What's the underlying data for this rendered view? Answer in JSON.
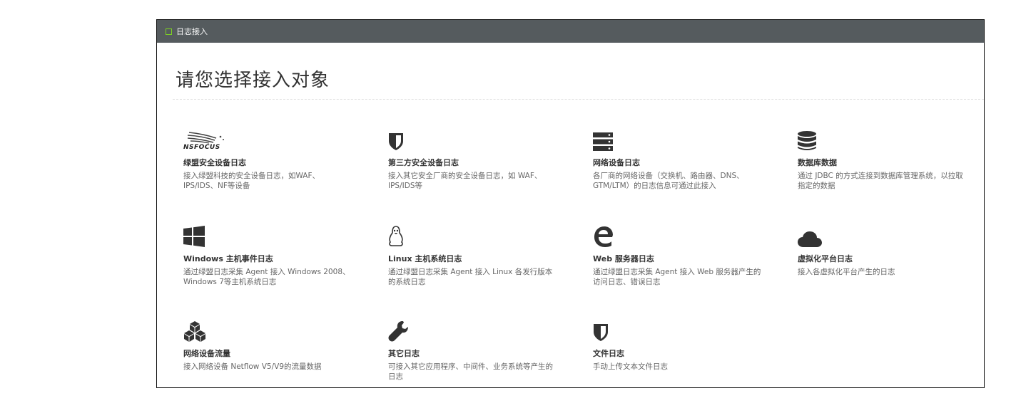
{
  "panel": {
    "title": "日志接入"
  },
  "heading": "请您选择接入对象",
  "cards": [
    {
      "icon": "nsfocus-logo",
      "logo_text": "NSFOCUS",
      "name": "绿盟安全设备日志",
      "desc_line1": "接入绿盟科技的安全设备日志，如WAF、",
      "desc_line2": "IPS/IDS、NF等设备"
    },
    {
      "icon": "shield-icon",
      "name": "第三方安全设备日志",
      "desc_line1": "接入其它安全厂商的安全设备日志，如 WAF、",
      "desc_line2": "IPS/IDS等"
    },
    {
      "icon": "server-icon",
      "name": "网络设备日志",
      "desc_line1": "各厂商的网络设备（交换机、路由器、DNS、",
      "desc_line2": "GTM/LTM）的日志信息可通过此接入"
    },
    {
      "icon": "database-icon",
      "name": "数据库数据",
      "desc_line1": "通过 JDBC 的方式连接到数据库管理系统，以拉取",
      "desc_line2": "指定的数据"
    },
    {
      "icon": "windows-icon",
      "name": "Windows 主机事件日志",
      "desc_line1": "通过绿盟日志采集 Agent 接入 Windows 2008、",
      "desc_line2": "Windows 7等主机系统日志"
    },
    {
      "icon": "linux-icon",
      "name": "Linux 主机系统日志",
      "desc_line1": "通过绿盟日志采集 Agent 接入 Linux 各发行版本",
      "desc_line2": "的系统日志"
    },
    {
      "icon": "edge-icon",
      "name": "Web 服务器日志",
      "desc_line1": "通过绿盟日志采集 Agent 接入 Web 服务器产生的",
      "desc_line2": "访问日志、错误日志"
    },
    {
      "icon": "cloud-icon",
      "name": "虚拟化平台日志",
      "desc_line1": "接入各虚拟化平台产生的日志",
      "desc_line2": ""
    },
    {
      "icon": "cubes-icon",
      "name": "网络设备流量",
      "desc_line1": "接入网络设备 Netflow V5/V9的流量数据",
      "desc_line2": ""
    },
    {
      "icon": "wrench-icon",
      "name": "其它日志",
      "desc_line1": "可接入其它应用程序、中间件、业务系统等产生的",
      "desc_line2": "日志"
    },
    {
      "icon": "shield-icon",
      "name": "文件日志",
      "desc_line1": "手动上传文本文件日志",
      "desc_line2": ""
    }
  ]
}
